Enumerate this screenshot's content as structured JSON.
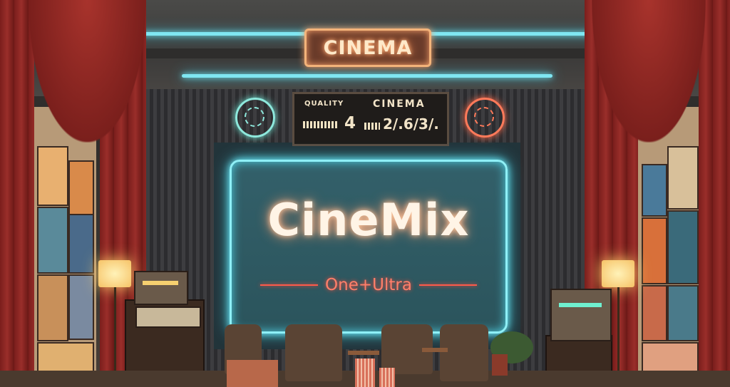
{
  "scene": {
    "description_alt": "Retro cinema lounge with red curtains, neon screen and jukeboxes"
  },
  "top_sign": {
    "text": "CINEMA"
  },
  "marquee_board": {
    "line1_left": "QUALITY",
    "line1_right": "CINEMA",
    "line2_left": "4",
    "line2_right": "2/.6/3/."
  },
  "screen": {
    "title": "CineMix",
    "subtitle": "One+Ultra"
  },
  "colors": {
    "neon_cyan": "#7fe6f2",
    "neon_orange": "#ffb67e",
    "neon_red": "#ff5a4a",
    "curtain_red": "#8a2622"
  }
}
